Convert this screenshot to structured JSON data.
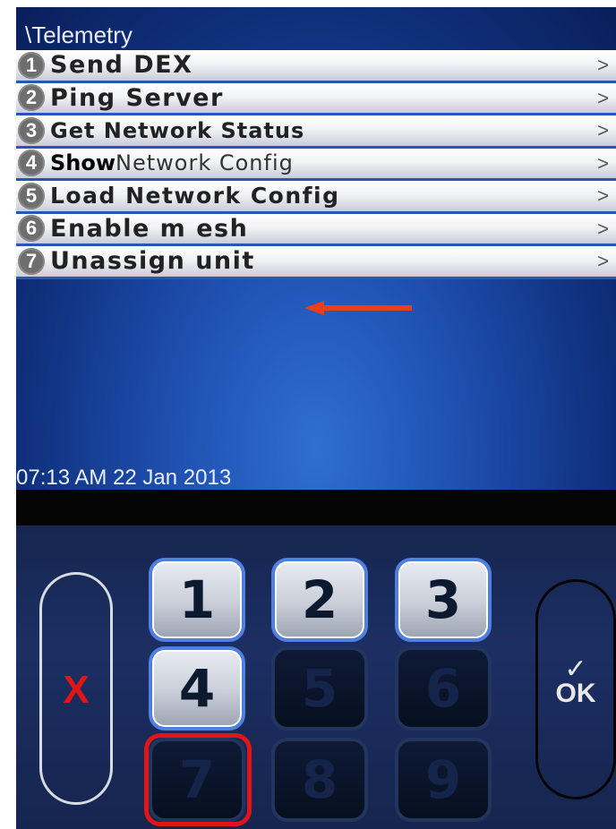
{
  "screen": {
    "title": "\\Telemetry",
    "datetime": "07:13 AM 22 Jan 2013"
  },
  "menu": {
    "items": [
      {
        "num": "1",
        "pre": "",
        "label": "Send DEX",
        "chevron": ">"
      },
      {
        "num": "2",
        "pre": "",
        "label": "Ping Server",
        "chevron": ">"
      },
      {
        "num": "3",
        "pre": "",
        "label": "Get Network Status",
        "chevron": ">"
      },
      {
        "num": "4",
        "pre": "Show",
        "label": "Network Config",
        "chevron": ">"
      },
      {
        "num": "5",
        "pre": "",
        "label": "Load Network Config",
        "chevron": ">"
      },
      {
        "num": "6",
        "pre": "",
        "label": "Enable m esh",
        "chevron": ">"
      },
      {
        "num": "7",
        "pre": "",
        "label": "Unassign unit",
        "chevron": ">"
      }
    ]
  },
  "keypad": {
    "cancel_label": "X",
    "ok_label": "OK",
    "ok_check": "✓",
    "keys": [
      "1",
      "2",
      "3",
      "4",
      "5",
      "6",
      "7",
      "8",
      "9"
    ],
    "enabled_keys": [
      "1",
      "2",
      "3",
      "4"
    ],
    "highlighted_key": "7"
  },
  "colors": {
    "highlight": "#e01515",
    "arrow": "#e8401a"
  }
}
